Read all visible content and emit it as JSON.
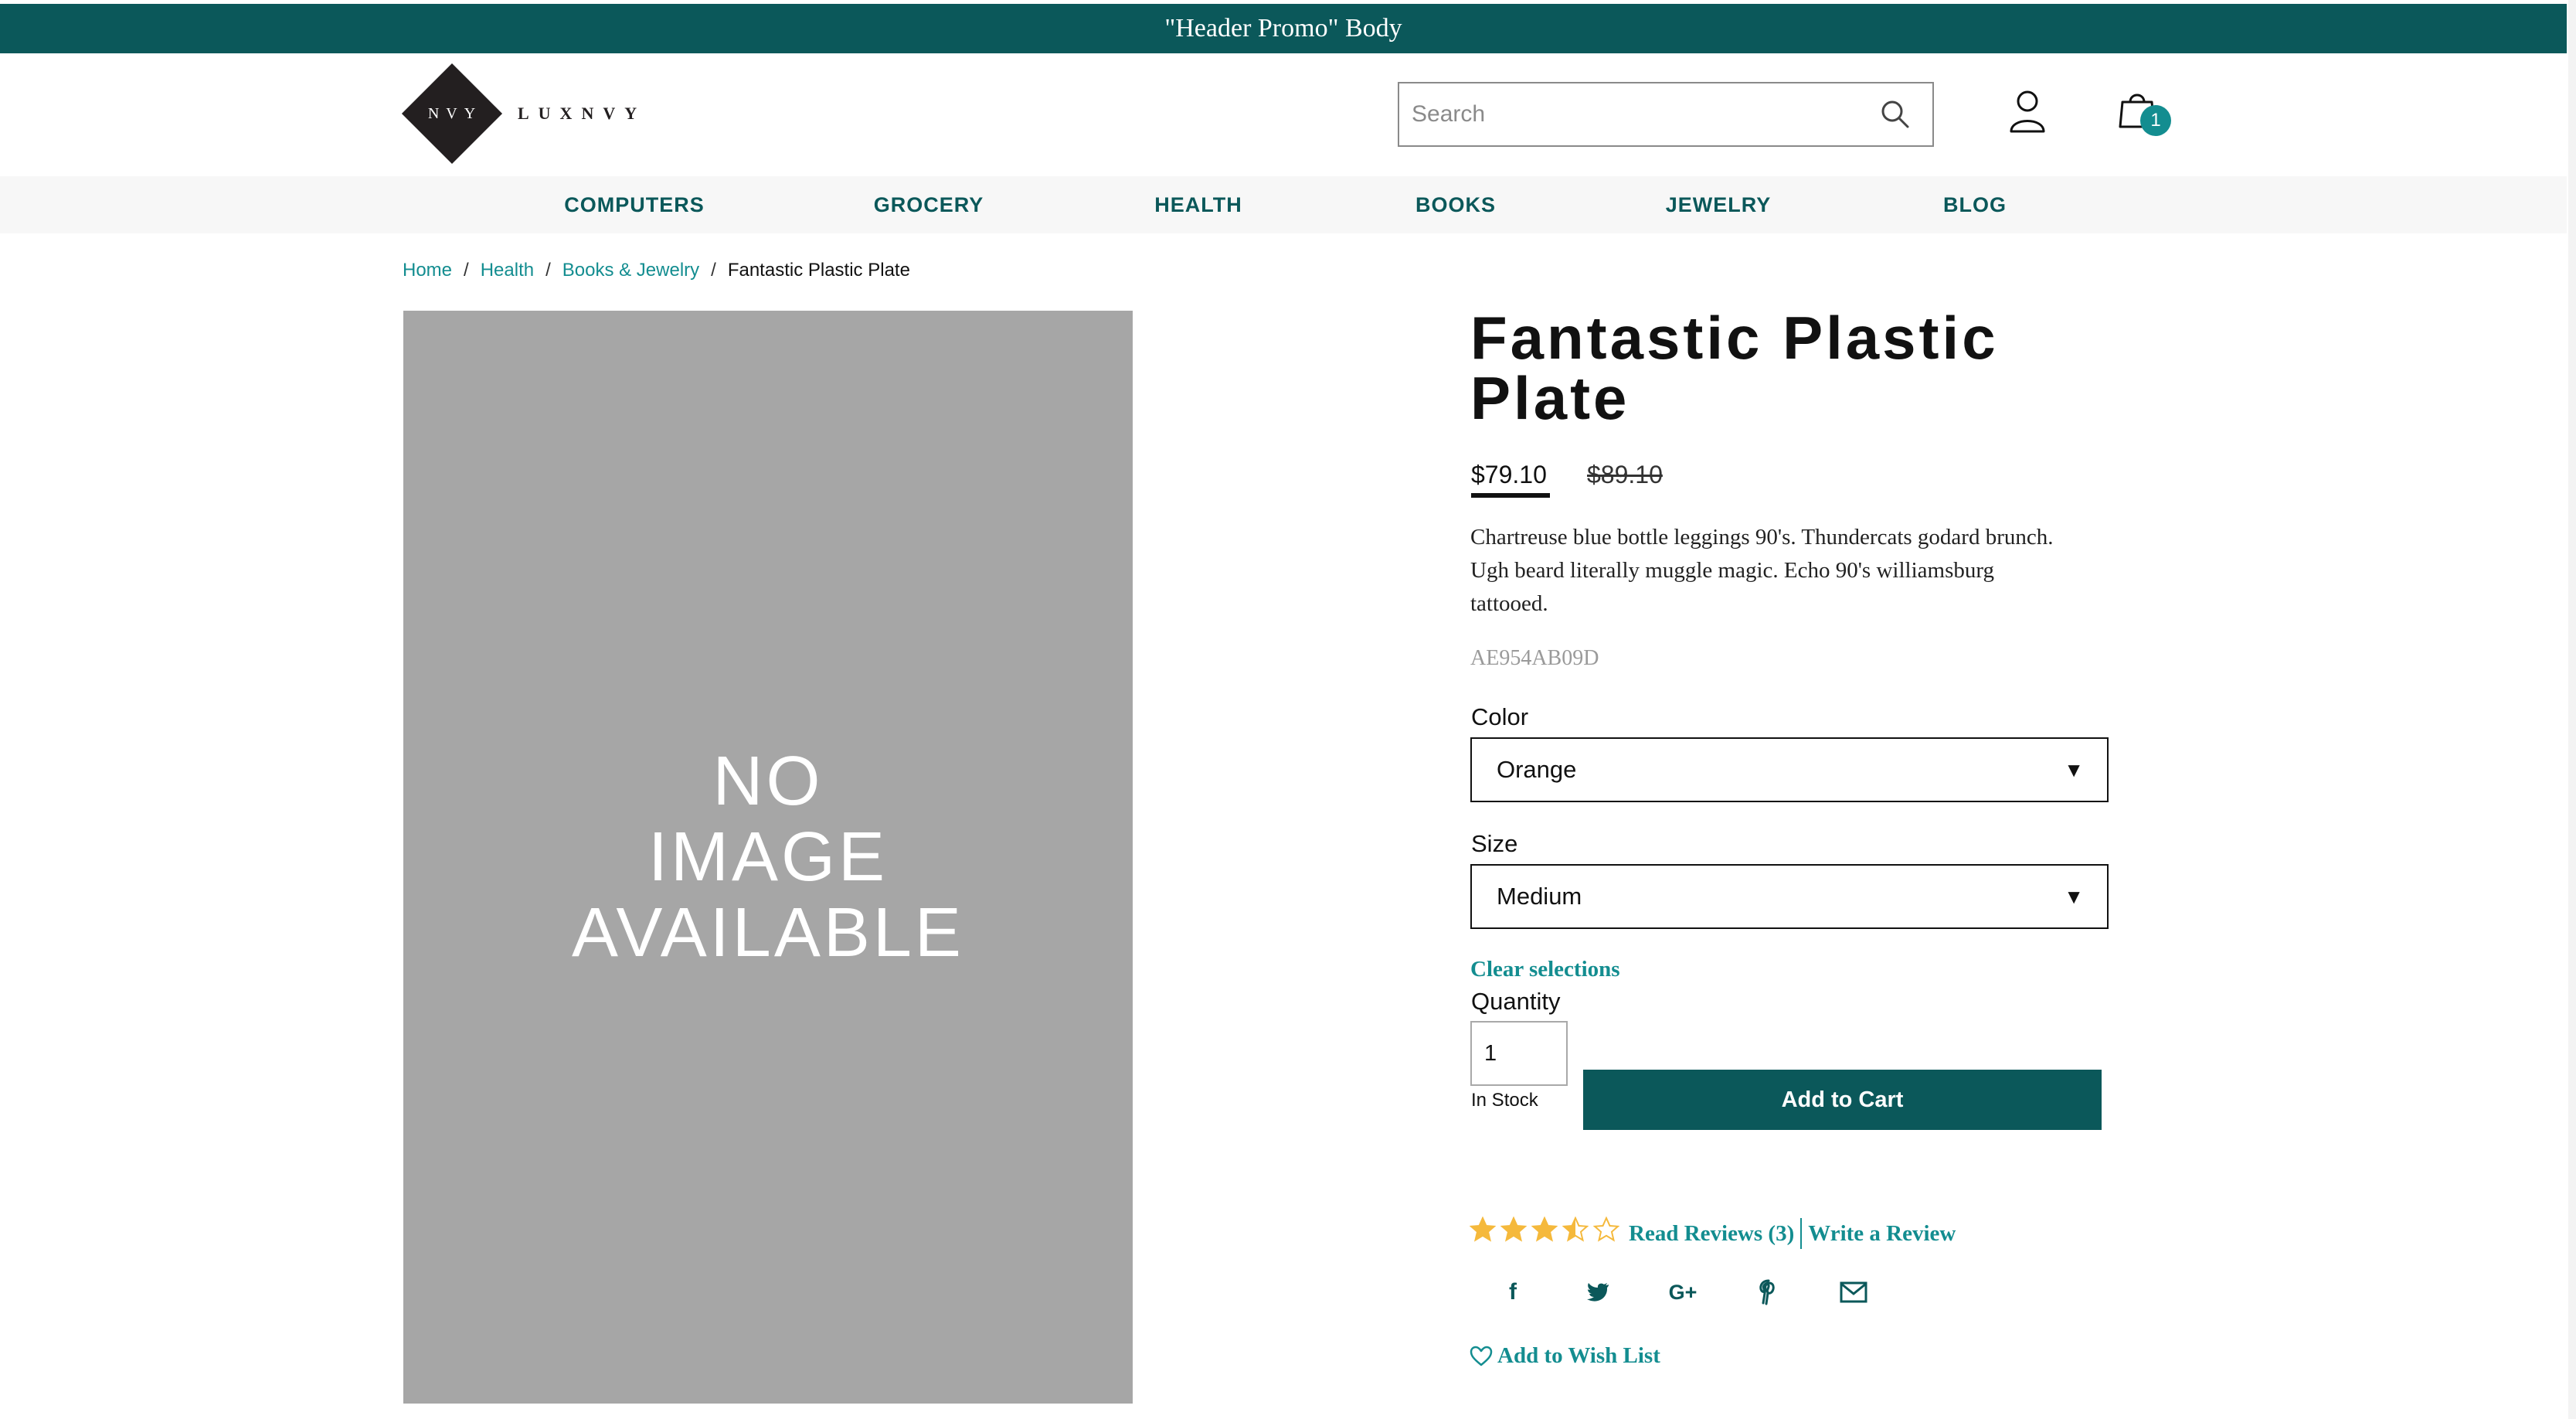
{
  "promo": {
    "text": "\"Header Promo\" Body"
  },
  "logo": {
    "mark": "NVY",
    "word": "LUXNVY"
  },
  "search": {
    "placeholder": "Search",
    "value": ""
  },
  "cart": {
    "count": "1"
  },
  "nav": {
    "items": [
      {
        "label": "COMPUTERS"
      },
      {
        "label": "GROCERY"
      },
      {
        "label": "HEALTH"
      },
      {
        "label": "BOOKS"
      },
      {
        "label": "JEWELRY"
      },
      {
        "label": "BLOG"
      }
    ]
  },
  "breadcrumb": {
    "items": [
      {
        "label": "Home"
      },
      {
        "label": "Health"
      },
      {
        "label": "Books & Jewelry"
      }
    ],
    "separator": "/",
    "current": "Fantastic Plastic Plate"
  },
  "image": {
    "placeholder_text": "NO\nIMAGE\nAVAILABLE"
  },
  "product": {
    "title": "Fantastic Plastic Plate",
    "price": "$79.10",
    "original_price": "$89.10",
    "description": "Chartreuse blue bottle leggings 90's. Thundercats godard brunch. Ugh beard literally muggle magic. Echo 90's williamsburg tattooed.",
    "sku": "AE954AB09D"
  },
  "options": {
    "color_label": "Color",
    "color_value": "Orange",
    "size_label": "Size",
    "size_value": "Medium",
    "arrow": "▼",
    "clear_label": "Clear selections"
  },
  "quantity": {
    "label": "Quantity",
    "value": "1",
    "stock": "In Stock"
  },
  "add_to_cart": {
    "label": "Add to Cart"
  },
  "rating": {
    "value": 3.5,
    "max": 5,
    "star_color": "#f5b93c"
  },
  "reviews": {
    "read_label": "Read Reviews (3)",
    "write_label": "Write a Review"
  },
  "social": {
    "icons": [
      "facebook-icon",
      "twitter-icon",
      "google-plus-icon",
      "pinterest-icon",
      "email-icon"
    ],
    "facebook_glyph": "f",
    "google_glyph": "G+"
  },
  "wishlist": {
    "label": "Add to Wish List"
  },
  "colors": {
    "brand": "#0b585a",
    "link": "#138d90",
    "image_placeholder": "#a6a6a6"
  }
}
